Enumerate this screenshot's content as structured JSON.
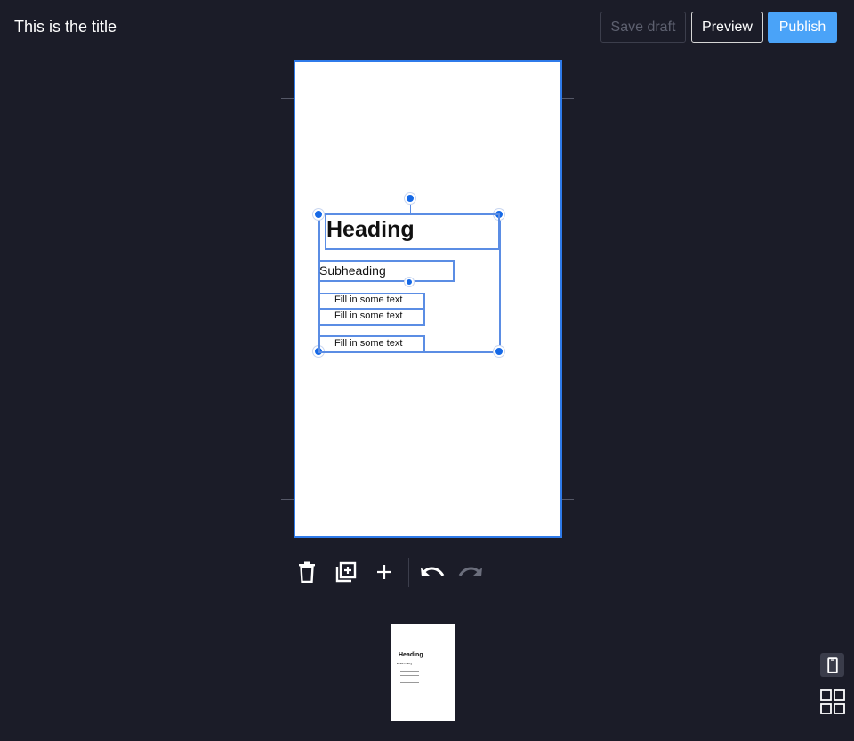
{
  "header": {
    "title": "This is the title",
    "save_draft_label": "Save draft",
    "preview_label": "Preview",
    "publish_label": "Publish"
  },
  "canvas": {
    "heading": "Heading",
    "subheading": "Subheading",
    "text_items": [
      "Fill in some text",
      "Fill in some text",
      "Fill in some text"
    ]
  },
  "thumbnail": {
    "heading": "Heading",
    "subheading": "Subheading"
  },
  "toolbar": {
    "icons": [
      "delete-icon",
      "duplicate-page-icon",
      "add-icon",
      "undo-icon",
      "redo-icon"
    ]
  },
  "colors": {
    "background": "#1b1c28",
    "accent": "#4aa3f8",
    "selection": "#5b8de4",
    "handle": "#1669e6"
  }
}
